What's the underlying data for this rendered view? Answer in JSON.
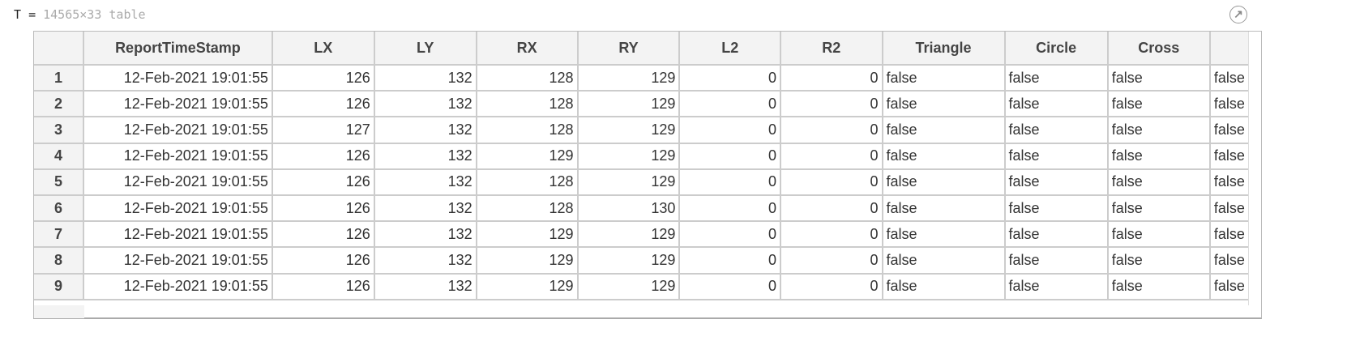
{
  "header": {
    "var_name": "T",
    "equals": "=",
    "summary": "14565×33 table"
  },
  "columns": [
    "",
    "ReportTimeStamp",
    "LX",
    "LY",
    "RX",
    "RY",
    "L2",
    "R2",
    "Triangle",
    "Circle",
    "Cross",
    ""
  ],
  "rows": [
    [
      "1",
      "12-Feb-2021 19:01:55",
      "126",
      "132",
      "128",
      "129",
      "0",
      "0",
      "false",
      "false",
      "false",
      "false"
    ],
    [
      "2",
      "12-Feb-2021 19:01:55",
      "126",
      "132",
      "128",
      "129",
      "0",
      "0",
      "false",
      "false",
      "false",
      "false"
    ],
    [
      "3",
      "12-Feb-2021 19:01:55",
      "127",
      "132",
      "128",
      "129",
      "0",
      "0",
      "false",
      "false",
      "false",
      "false"
    ],
    [
      "4",
      "12-Feb-2021 19:01:55",
      "126",
      "132",
      "129",
      "129",
      "0",
      "0",
      "false",
      "false",
      "false",
      "false"
    ],
    [
      "5",
      "12-Feb-2021 19:01:55",
      "126",
      "132",
      "128",
      "129",
      "0",
      "0",
      "false",
      "false",
      "false",
      "false"
    ],
    [
      "6",
      "12-Feb-2021 19:01:55",
      "126",
      "132",
      "128",
      "130",
      "0",
      "0",
      "false",
      "false",
      "false",
      "false"
    ],
    [
      "7",
      "12-Feb-2021 19:01:55",
      "126",
      "132",
      "129",
      "129",
      "0",
      "0",
      "false",
      "false",
      "false",
      "false"
    ],
    [
      "8",
      "12-Feb-2021 19:01:55",
      "126",
      "132",
      "129",
      "129",
      "0",
      "0",
      "false",
      "false",
      "false",
      "false"
    ],
    [
      "9",
      "12-Feb-2021 19:01:55",
      "126",
      "132",
      "129",
      "129",
      "0",
      "0",
      "false",
      "false",
      "false",
      "false"
    ]
  ],
  "icons": {
    "open_in_variable_editor": "arrow-up-right-circle-icon"
  }
}
